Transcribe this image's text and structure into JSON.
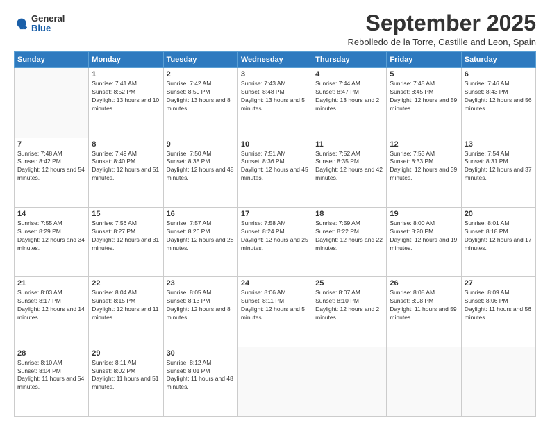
{
  "logo": {
    "general": "General",
    "blue": "Blue"
  },
  "header": {
    "title": "September 2025",
    "subtitle": "Rebolledo de la Torre, Castille and Leon, Spain"
  },
  "weekdays": [
    "Sunday",
    "Monday",
    "Tuesday",
    "Wednesday",
    "Thursday",
    "Friday",
    "Saturday"
  ],
  "weeks": [
    [
      {
        "day": "",
        "sunrise": "",
        "sunset": "",
        "daylight": ""
      },
      {
        "day": "1",
        "sunrise": "Sunrise: 7:41 AM",
        "sunset": "Sunset: 8:52 PM",
        "daylight": "Daylight: 13 hours and 10 minutes."
      },
      {
        "day": "2",
        "sunrise": "Sunrise: 7:42 AM",
        "sunset": "Sunset: 8:50 PM",
        "daylight": "Daylight: 13 hours and 8 minutes."
      },
      {
        "day": "3",
        "sunrise": "Sunrise: 7:43 AM",
        "sunset": "Sunset: 8:48 PM",
        "daylight": "Daylight: 13 hours and 5 minutes."
      },
      {
        "day": "4",
        "sunrise": "Sunrise: 7:44 AM",
        "sunset": "Sunset: 8:47 PM",
        "daylight": "Daylight: 13 hours and 2 minutes."
      },
      {
        "day": "5",
        "sunrise": "Sunrise: 7:45 AM",
        "sunset": "Sunset: 8:45 PM",
        "daylight": "Daylight: 12 hours and 59 minutes."
      },
      {
        "day": "6",
        "sunrise": "Sunrise: 7:46 AM",
        "sunset": "Sunset: 8:43 PM",
        "daylight": "Daylight: 12 hours and 56 minutes."
      }
    ],
    [
      {
        "day": "7",
        "sunrise": "Sunrise: 7:48 AM",
        "sunset": "Sunset: 8:42 PM",
        "daylight": "Daylight: 12 hours and 54 minutes."
      },
      {
        "day": "8",
        "sunrise": "Sunrise: 7:49 AM",
        "sunset": "Sunset: 8:40 PM",
        "daylight": "Daylight: 12 hours and 51 minutes."
      },
      {
        "day": "9",
        "sunrise": "Sunrise: 7:50 AM",
        "sunset": "Sunset: 8:38 PM",
        "daylight": "Daylight: 12 hours and 48 minutes."
      },
      {
        "day": "10",
        "sunrise": "Sunrise: 7:51 AM",
        "sunset": "Sunset: 8:36 PM",
        "daylight": "Daylight: 12 hours and 45 minutes."
      },
      {
        "day": "11",
        "sunrise": "Sunrise: 7:52 AM",
        "sunset": "Sunset: 8:35 PM",
        "daylight": "Daylight: 12 hours and 42 minutes."
      },
      {
        "day": "12",
        "sunrise": "Sunrise: 7:53 AM",
        "sunset": "Sunset: 8:33 PM",
        "daylight": "Daylight: 12 hours and 39 minutes."
      },
      {
        "day": "13",
        "sunrise": "Sunrise: 7:54 AM",
        "sunset": "Sunset: 8:31 PM",
        "daylight": "Daylight: 12 hours and 37 minutes."
      }
    ],
    [
      {
        "day": "14",
        "sunrise": "Sunrise: 7:55 AM",
        "sunset": "Sunset: 8:29 PM",
        "daylight": "Daylight: 12 hours and 34 minutes."
      },
      {
        "day": "15",
        "sunrise": "Sunrise: 7:56 AM",
        "sunset": "Sunset: 8:27 PM",
        "daylight": "Daylight: 12 hours and 31 minutes."
      },
      {
        "day": "16",
        "sunrise": "Sunrise: 7:57 AM",
        "sunset": "Sunset: 8:26 PM",
        "daylight": "Daylight: 12 hours and 28 minutes."
      },
      {
        "day": "17",
        "sunrise": "Sunrise: 7:58 AM",
        "sunset": "Sunset: 8:24 PM",
        "daylight": "Daylight: 12 hours and 25 minutes."
      },
      {
        "day": "18",
        "sunrise": "Sunrise: 7:59 AM",
        "sunset": "Sunset: 8:22 PM",
        "daylight": "Daylight: 12 hours and 22 minutes."
      },
      {
        "day": "19",
        "sunrise": "Sunrise: 8:00 AM",
        "sunset": "Sunset: 8:20 PM",
        "daylight": "Daylight: 12 hours and 19 minutes."
      },
      {
        "day": "20",
        "sunrise": "Sunrise: 8:01 AM",
        "sunset": "Sunset: 8:18 PM",
        "daylight": "Daylight: 12 hours and 17 minutes."
      }
    ],
    [
      {
        "day": "21",
        "sunrise": "Sunrise: 8:03 AM",
        "sunset": "Sunset: 8:17 PM",
        "daylight": "Daylight: 12 hours and 14 minutes."
      },
      {
        "day": "22",
        "sunrise": "Sunrise: 8:04 AM",
        "sunset": "Sunset: 8:15 PM",
        "daylight": "Daylight: 12 hours and 11 minutes."
      },
      {
        "day": "23",
        "sunrise": "Sunrise: 8:05 AM",
        "sunset": "Sunset: 8:13 PM",
        "daylight": "Daylight: 12 hours and 8 minutes."
      },
      {
        "day": "24",
        "sunrise": "Sunrise: 8:06 AM",
        "sunset": "Sunset: 8:11 PM",
        "daylight": "Daylight: 12 hours and 5 minutes."
      },
      {
        "day": "25",
        "sunrise": "Sunrise: 8:07 AM",
        "sunset": "Sunset: 8:10 PM",
        "daylight": "Daylight: 12 hours and 2 minutes."
      },
      {
        "day": "26",
        "sunrise": "Sunrise: 8:08 AM",
        "sunset": "Sunset: 8:08 PM",
        "daylight": "Daylight: 11 hours and 59 minutes."
      },
      {
        "day": "27",
        "sunrise": "Sunrise: 8:09 AM",
        "sunset": "Sunset: 8:06 PM",
        "daylight": "Daylight: 11 hours and 56 minutes."
      }
    ],
    [
      {
        "day": "28",
        "sunrise": "Sunrise: 8:10 AM",
        "sunset": "Sunset: 8:04 PM",
        "daylight": "Daylight: 11 hours and 54 minutes."
      },
      {
        "day": "29",
        "sunrise": "Sunrise: 8:11 AM",
        "sunset": "Sunset: 8:02 PM",
        "daylight": "Daylight: 11 hours and 51 minutes."
      },
      {
        "day": "30",
        "sunrise": "Sunrise: 8:12 AM",
        "sunset": "Sunset: 8:01 PM",
        "daylight": "Daylight: 11 hours and 48 minutes."
      },
      {
        "day": "",
        "sunrise": "",
        "sunset": "",
        "daylight": ""
      },
      {
        "day": "",
        "sunrise": "",
        "sunset": "",
        "daylight": ""
      },
      {
        "day": "",
        "sunrise": "",
        "sunset": "",
        "daylight": ""
      },
      {
        "day": "",
        "sunrise": "",
        "sunset": "",
        "daylight": ""
      }
    ]
  ]
}
